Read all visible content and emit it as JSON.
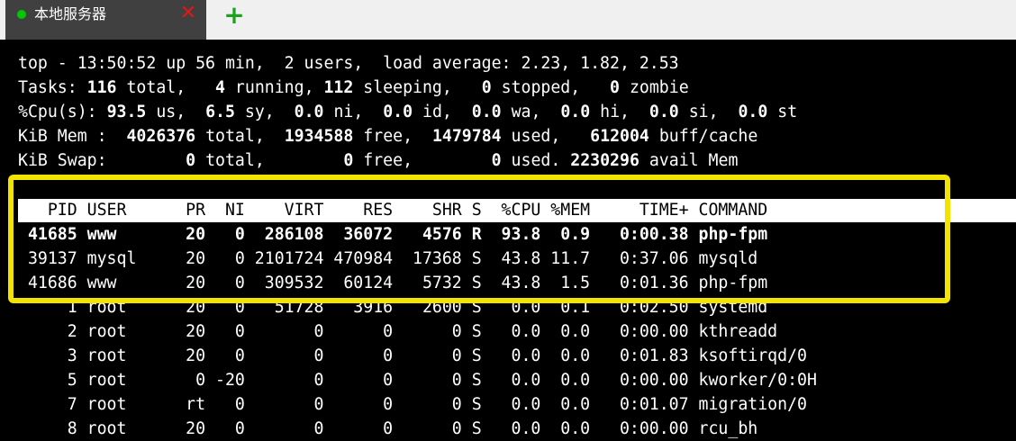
{
  "tabs": [
    {
      "title": "本地服务器",
      "status": "connected",
      "close_icon": "close-icon"
    }
  ],
  "add_tab_icon": "plus-icon",
  "top_summary": {
    "line1": "top - 13:50:52 up 56 min,  2 users,  load average: 2.23, 1.82, 2.53",
    "tasks": {
      "label": "Tasks:",
      "total": "116",
      "running": "4",
      "sleeping": "112",
      "stopped": "0",
      "zombie": "0"
    },
    "cpu": {
      "label": "%Cpu(s):",
      "us": "93.5",
      "sy": "6.5",
      "ni": "0.0",
      "id": "0.0",
      "wa": "0.0",
      "hi": "0.0",
      "si": "0.0",
      "st": "0.0"
    },
    "mem": {
      "label": "KiB Mem :",
      "total": "4026376",
      "free": "1934588",
      "used": "1479784",
      "buff_cache": "612004"
    },
    "swap": {
      "label": "KiB Swap:",
      "total": "0",
      "free": "0",
      "used": "0",
      "avail_mem": "2230296"
    }
  },
  "process_table": {
    "columns": [
      "PID",
      "USER",
      "PR",
      "NI",
      "VIRT",
      "RES",
      "SHR",
      "S",
      "%CPU",
      "%MEM",
      "TIME+",
      "COMMAND"
    ],
    "rows": [
      {
        "pid": "41685",
        "user": "www",
        "pr": "20",
        "ni": "0",
        "virt": "286108",
        "res": "36072",
        "shr": "4576",
        "s": "R",
        "cpu": "93.8",
        "mem": "0.9",
        "time": "0:00.38",
        "command": "php-fpm",
        "bold": true
      },
      {
        "pid": "39137",
        "user": "mysql",
        "pr": "20",
        "ni": "0",
        "virt": "2101724",
        "res": "470984",
        "shr": "17368",
        "s": "S",
        "cpu": "43.8",
        "mem": "11.7",
        "time": "0:37.06",
        "command": "mysqld",
        "bold": false
      },
      {
        "pid": "41686",
        "user": "www",
        "pr": "20",
        "ni": "0",
        "virt": "309532",
        "res": "60124",
        "shr": "5732",
        "s": "S",
        "cpu": "43.8",
        "mem": "1.5",
        "time": "0:01.36",
        "command": "php-fpm",
        "bold": false
      },
      {
        "pid": "1",
        "user": "root",
        "pr": "20",
        "ni": "0",
        "virt": "51728",
        "res": "3916",
        "shr": "2600",
        "s": "S",
        "cpu": "0.0",
        "mem": "0.1",
        "time": "0:02.50",
        "command": "systemd",
        "bold": false
      },
      {
        "pid": "2",
        "user": "root",
        "pr": "20",
        "ni": "0",
        "virt": "0",
        "res": "0",
        "shr": "0",
        "s": "S",
        "cpu": "0.0",
        "mem": "0.0",
        "time": "0:00.00",
        "command": "kthreadd",
        "bold": false
      },
      {
        "pid": "3",
        "user": "root",
        "pr": "20",
        "ni": "0",
        "virt": "0",
        "res": "0",
        "shr": "0",
        "s": "S",
        "cpu": "0.0",
        "mem": "0.0",
        "time": "0:01.83",
        "command": "ksoftirqd/0",
        "bold": false
      },
      {
        "pid": "5",
        "user": "root",
        "pr": "0",
        "ni": "-20",
        "virt": "0",
        "res": "0",
        "shr": "0",
        "s": "S",
        "cpu": "0.0",
        "mem": "0.0",
        "time": "0:00.00",
        "command": "kworker/0:0H",
        "bold": false
      },
      {
        "pid": "7",
        "user": "root",
        "pr": "rt",
        "ni": "0",
        "virt": "0",
        "res": "0",
        "shr": "0",
        "s": "S",
        "cpu": "0.0",
        "mem": "0.0",
        "time": "0:01.07",
        "command": "migration/0",
        "bold": false
      },
      {
        "pid": "8",
        "user": "root",
        "pr": "20",
        "ni": "0",
        "virt": "0",
        "res": "0",
        "shr": "0",
        "s": "S",
        "cpu": "0.0",
        "mem": "0.0",
        "time": "0:00.00",
        "command": "rcu_bh",
        "bold": false
      }
    ]
  },
  "colors": {
    "highlight": "#f2e400",
    "terminal_bg": "#000000",
    "terminal_fg": "#ffffff",
    "tab_bg": "#404040",
    "close_red": "#e01818",
    "add_green": "#20a020"
  }
}
